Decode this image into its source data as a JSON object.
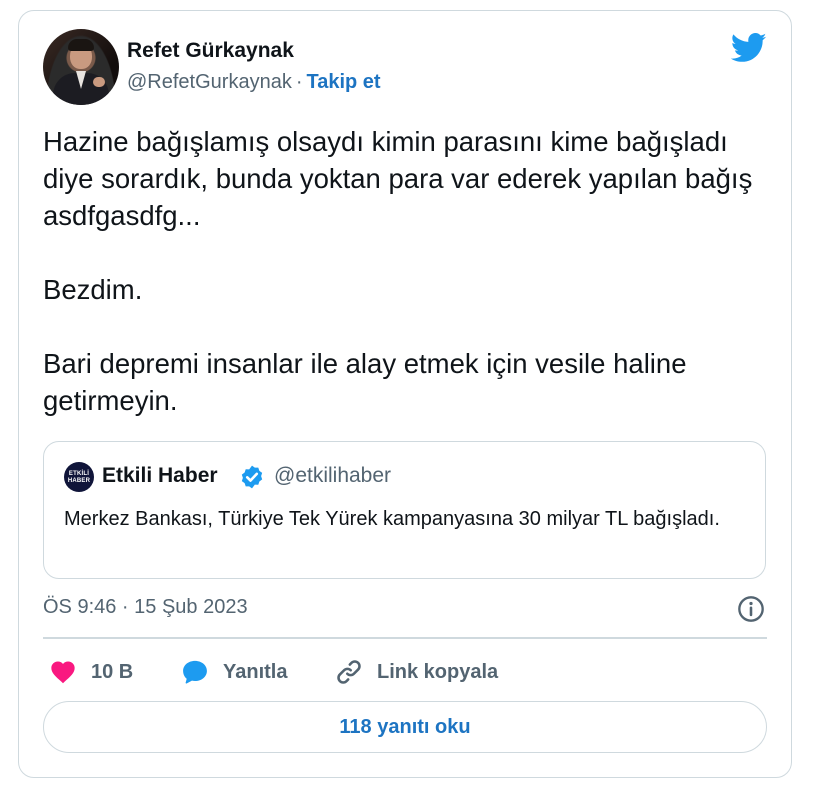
{
  "author": {
    "name": "Refet Gürkaynak",
    "handle": "@RefetGurkaynak",
    "separator": "·",
    "follow_label": "Takip et"
  },
  "tweet": {
    "text": "Hazine bağışlamış olsaydı kimin parasını kime bağışladı diye sorardık, bunda yoktan para var ederek yapılan bağış asdfgasdfg...\n\nBezdim.\n\nBari depremi insanlar ile alay etmek için vesile haline getirmeyin."
  },
  "quote": {
    "logo_text_top": "ETKİLİ",
    "logo_text_bottom": "HABER",
    "name": "Etkili Haber",
    "handle": "@etkilihaber",
    "text": "Merkez Bankası, Türkiye Tek Yürek kampanyasına 30 milyar TL bağışladı."
  },
  "meta": {
    "timestamp": "ÖS 9:46 · 15 Şub 2023"
  },
  "actions": {
    "like_count": "10 B",
    "reply_label": "Yanıtla",
    "copy_link_label": "Link kopyala"
  },
  "read_replies_label": "118 yanıtı oku",
  "icons": {
    "brand": "twitter-bird-icon",
    "verified": "verified-badge-icon",
    "info": "info-icon",
    "like": "heart-icon",
    "reply": "speech-bubble-icon",
    "link": "link-icon"
  },
  "colors": {
    "brand_blue": "#1d9bf0",
    "link_blue": "#1d74c2",
    "heart": "#f91880",
    "text": "#0f1419",
    "muted": "#536471",
    "border": "#cfd9de"
  }
}
